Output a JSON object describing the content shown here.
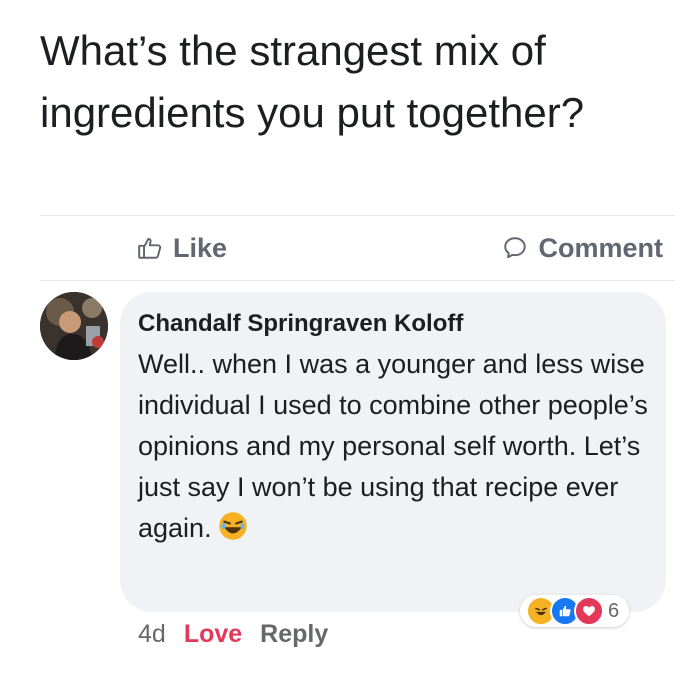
{
  "post": {
    "text": "What’s the strangest mix of ingredients you put together?"
  },
  "actions": {
    "like_label": "Like",
    "comment_label": "Comment"
  },
  "comment": {
    "author": "Chandalf Springraven Koloff",
    "text": "Well.. when I was a younger and less wise individual I used to combine other people’s opinions and my personal self worth. Let’s just say I won’t be using that recipe ever again.",
    "time": "4d",
    "love_label": "Love",
    "reply_label": "Reply",
    "reaction_count": "6",
    "reactions": [
      "laugh-icon",
      "like-icon",
      "love-icon"
    ]
  },
  "colors": {
    "love": "#e4385b",
    "like": "#1877f2",
    "laugh": "#f7b125",
    "bubble": "#f0f2f5",
    "muted": "#65676b"
  }
}
